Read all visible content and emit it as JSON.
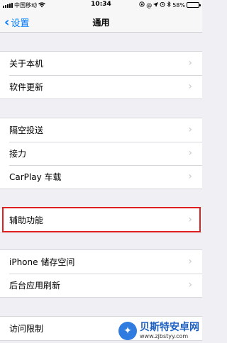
{
  "status": {
    "carrier": "中国移动",
    "time": "10:34",
    "battery_text": "58%",
    "battery_level": 0.58
  },
  "nav": {
    "back_label": "设置",
    "title": "通用"
  },
  "groups": [
    {
      "items": [
        {
          "label": "关于本机"
        },
        {
          "label": "软件更新"
        }
      ]
    },
    {
      "items": [
        {
          "label": "隔空投送"
        },
        {
          "label": "接力"
        },
        {
          "label": "CarPlay 车载"
        }
      ]
    },
    {
      "items": [
        {
          "label": "辅助功能"
        }
      ]
    },
    {
      "items": [
        {
          "label": "iPhone 储存空间"
        },
        {
          "label": "后台应用刷新"
        }
      ]
    },
    {
      "items": [
        {
          "label": "访问限制"
        }
      ]
    }
  ],
  "watermark": {
    "name": "贝斯特安卓网",
    "url": "www.zjbstyy.com"
  }
}
